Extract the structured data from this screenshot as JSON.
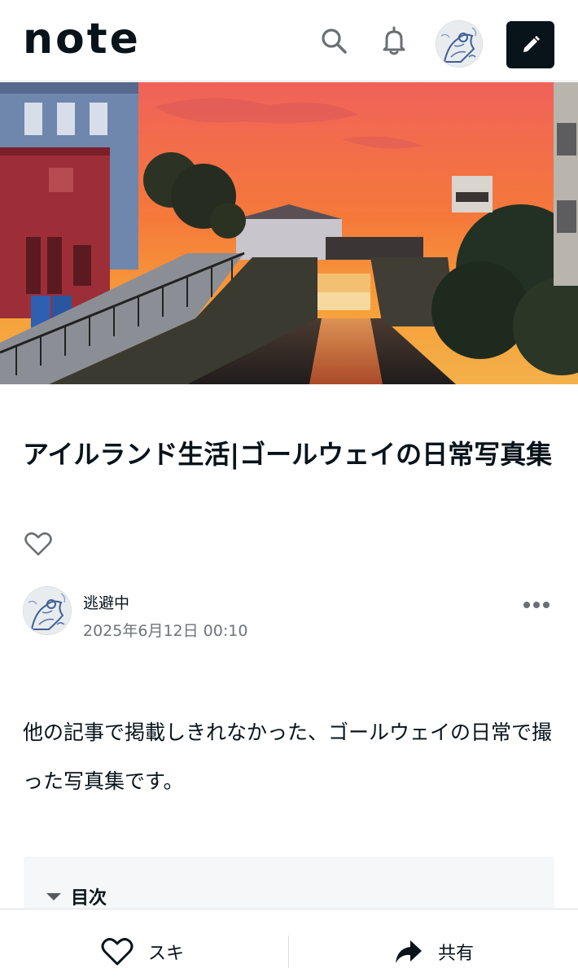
{
  "header": {
    "logo_text": "note",
    "icons": [
      "search-icon",
      "bell-icon",
      "user-avatar",
      "pencil-icon"
    ]
  },
  "article": {
    "title": "アイルランド生活|ゴールウェイの日常写真集",
    "author": {
      "name": "逃避中",
      "date": "2025年6月12日 00:10"
    },
    "body": "他の記事で掲載しきれなかった、ゴールウェイの日常で撮った写真集です。",
    "toc_label": "目次"
  },
  "bottom_bar": {
    "like_label": "スキ",
    "share_label": "共有"
  },
  "colors": {
    "text": "#08131a",
    "muted": "#6f7479",
    "toc_bg": "#f5f7f9",
    "post_button": "#08131a"
  }
}
